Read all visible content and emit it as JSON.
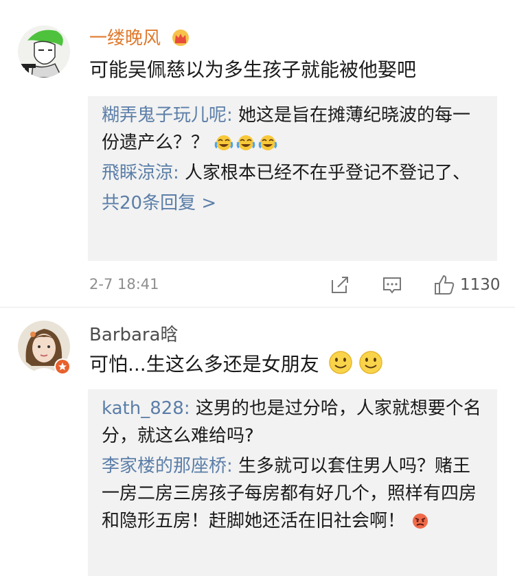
{
  "comments": [
    {
      "username": "一缕晚风",
      "text": "可能吴佩慈以为多生孩子就能被他娶吧",
      "replies": [
        {
          "user": "糊弄鬼子玩儿呢",
          "text": "她这是旨在摊薄纪晓波的每一份遗产么？？"
        },
        {
          "user": "飛睬涼涼",
          "text": "人家根本已经不在乎登记不登记了、"
        }
      ],
      "more_replies": "共20条回复 >",
      "time": "2-7 18:41",
      "like_count": "1130",
      "badge_icon": "crown-icon",
      "reply_emoji": "laugh-cry-emoji"
    },
    {
      "username": "Barbara晗",
      "text": "可怕...生这么多还是女朋友",
      "text_emoji": "smile-emoji",
      "replies": [
        {
          "user": "kath_828",
          "text": "这男的也是过分哈，人家就想要个名分，就这么难给吗?"
        },
        {
          "user": "李家楼的那座桥",
          "text": "生多就可以套住男人吗？赌王一房二房三房孩子每房都有好几个，照样有四房和隐形五房！赶脚她还活在旧社会啊！"
        }
      ],
      "reply_emoji": "angry-emoji"
    }
  ],
  "colors": {
    "vip_name": "#e07a2e",
    "link": "#5b7ea8",
    "reply_bg": "#f2f2f2",
    "meta_gray": "#8e8e8e"
  }
}
